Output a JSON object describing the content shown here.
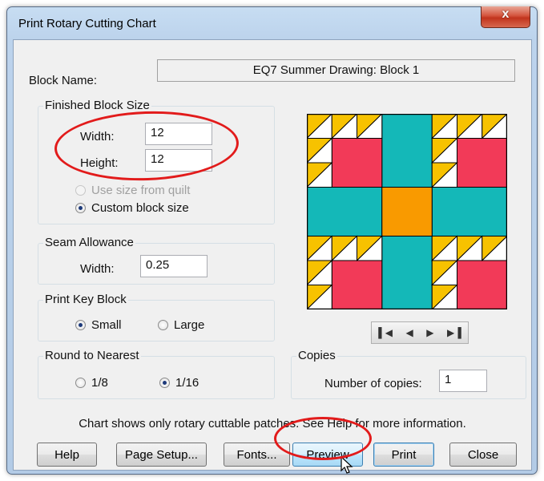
{
  "window": {
    "title": "Print Rotary Cutting Chart",
    "close_glyph": "x"
  },
  "block_name": {
    "label": "Block Name:",
    "value": "EQ7 Summer Drawing: Block 1"
  },
  "finished_block_size": {
    "title": "Finished Block Size",
    "width_label": "Width:",
    "width_value": "12",
    "height_label": "Height:",
    "height_value": "12",
    "use_size_from_quilt": "Use size from quilt",
    "custom_block_size": "Custom block size",
    "selected": "custom_block_size"
  },
  "seam_allowance": {
    "title": "Seam Allowance",
    "width_label": "Width:",
    "width_value": "0.25"
  },
  "print_key_block": {
    "title": "Print Key Block",
    "options": [
      "Small",
      "Large"
    ],
    "selected": "Small"
  },
  "round_to_nearest": {
    "title": "Round to Nearest",
    "options": [
      "1/8",
      "1/16"
    ],
    "selected": "1/16"
  },
  "copies": {
    "title": "Copies",
    "label": "Number of copies:",
    "value": "1"
  },
  "nav_icons": [
    "first-icon",
    "prev-icon",
    "next-icon",
    "last-icon"
  ],
  "info_text": "Chart shows only rotary cuttable patches. See Help for more information.",
  "buttons": {
    "help": "Help",
    "page_setup": "Page Setup...",
    "fonts": "Fonts...",
    "preview": "Preview",
    "print": "Print",
    "close": "Close"
  },
  "block_colors": {
    "teal": "#14b8b8",
    "orange": "#f99a00",
    "red": "#f23a58",
    "yellow": "#f7c200",
    "white": "#ffffff",
    "outline": "#000000"
  },
  "annotation_color": "#e21b1b"
}
